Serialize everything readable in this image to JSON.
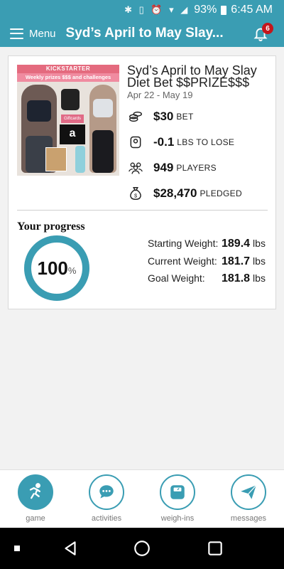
{
  "status_bar": {
    "battery": "93%",
    "time": "6:45 AM"
  },
  "header": {
    "menu_label": "Menu",
    "title": "Syd’s April to May Slay...",
    "notification_count": "6"
  },
  "bet": {
    "image_banner": "KICKSTARTER",
    "image_sub_banner": "Weekly prizes $$$ and challenges",
    "image_giftcards_label": "Giftcards",
    "image_amazon_logo": "a",
    "title_line1": "Syd’s April to May Slay",
    "title_line2": "Diet Bet $$PRIZE$$$",
    "dates": "Apr 22 - May 19",
    "stats": [
      {
        "icon": "coins-icon",
        "value": "$30",
        "label": "BET"
      },
      {
        "icon": "scale-icon",
        "value": "-0.1",
        "label": "LBS TO LOSE"
      },
      {
        "icon": "people-icon",
        "value": "949",
        "label": "PLAYERS"
      },
      {
        "icon": "money-bag-icon",
        "value": "$28,470",
        "label": "PLEDGED"
      }
    ]
  },
  "progress": {
    "title": "Your progress",
    "percent": "100",
    "percent_unit": "%",
    "percent_fraction": 1.0,
    "weights": [
      {
        "label": "Starting Weight:",
        "value": "189.4",
        "unit": "lbs"
      },
      {
        "label": "Current Weight:",
        "value": "181.7",
        "unit": "lbs"
      },
      {
        "label": "Goal Weight:",
        "value": "181.8",
        "unit": "lbs"
      }
    ]
  },
  "nav": [
    {
      "label": "game",
      "icon": "runner-icon",
      "active": true
    },
    {
      "label": "activities",
      "icon": "chat-bubble-icon",
      "active": false
    },
    {
      "label": "weigh-ins",
      "icon": "scale-icon",
      "active": false
    },
    {
      "label": "messages",
      "icon": "send-icon",
      "active": false
    }
  ],
  "colors": {
    "primary": "#3a9db3",
    "badge": "#c4161c"
  }
}
